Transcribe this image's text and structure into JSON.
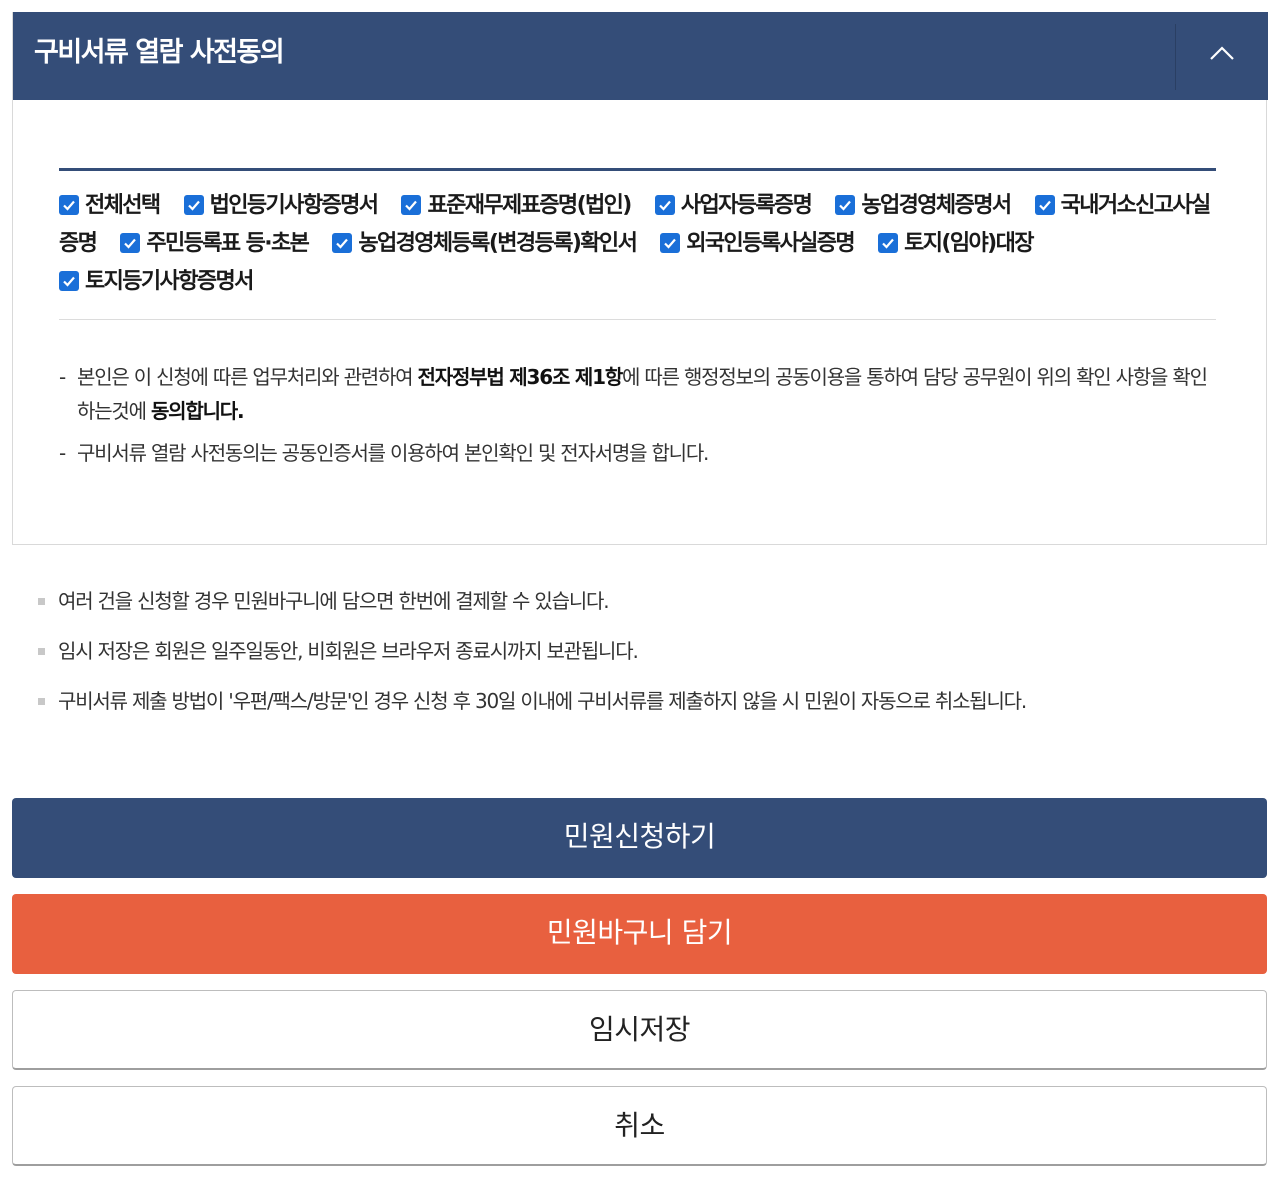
{
  "panel": {
    "title": "구비서류 열람 사전동의",
    "colors": {
      "header": "#344d78",
      "checkbox": "#1a6fd8"
    }
  },
  "checkboxes": [
    {
      "label": "전체선택",
      "checked": true
    },
    {
      "label": "법인등기사항증명서",
      "checked": true
    },
    {
      "label": "표준재무제표증명(법인)",
      "checked": true
    },
    {
      "label": "사업자등록증명",
      "checked": true
    },
    {
      "label": "농업경영체증명서",
      "checked": true
    },
    {
      "label": "국내거소신고사실증명",
      "checked": true
    },
    {
      "label": "주민등록표 등·초본",
      "checked": true
    },
    {
      "label": "농업경영체등록(변경등록)확인서",
      "checked": true
    },
    {
      "label": "외국인등록사실증명",
      "checked": true
    },
    {
      "label": "토지(임야)대장",
      "checked": true
    },
    {
      "label": "토지등기사항증명서",
      "checked": true
    }
  ],
  "agreement": {
    "line1_pre": "본인은 이 신청에 따른 업무처리와 관련하여 ",
    "line1_bold": "전자정부법 제36조 제1항",
    "line1_mid": "에 따른 행정정보의 공동이용을 통하여 담당 공무원이 위의 확인 사항을 확인하는것에 ",
    "line1_bold2": "동의합니다.",
    "line2": "구비서류 열람 사전동의는 공동인증서를 이용하여 본인확인 및 전자서명을 합니다."
  },
  "notes": [
    "여러 건을 신청할 경우 민원바구니에 담으면 한번에 결제할 수 있습니다.",
    "임시 저장은 회원은 일주일동안, 비회원은 브라우저 종료시까지 보관됩니다.",
    "구비서류 제출 방법이 '우편/팩스/방문'인 경우 신청 후 30일 이내에 구비서류를 제출하지 않을 시 민원이 자동으로 취소됩니다."
  ],
  "buttons": {
    "apply": "민원신청하기",
    "basket": "민원바구니 담기",
    "save": "임시저장",
    "cancel": "취소",
    "colors": {
      "apply": "#344d78",
      "basket": "#e8603f"
    }
  }
}
